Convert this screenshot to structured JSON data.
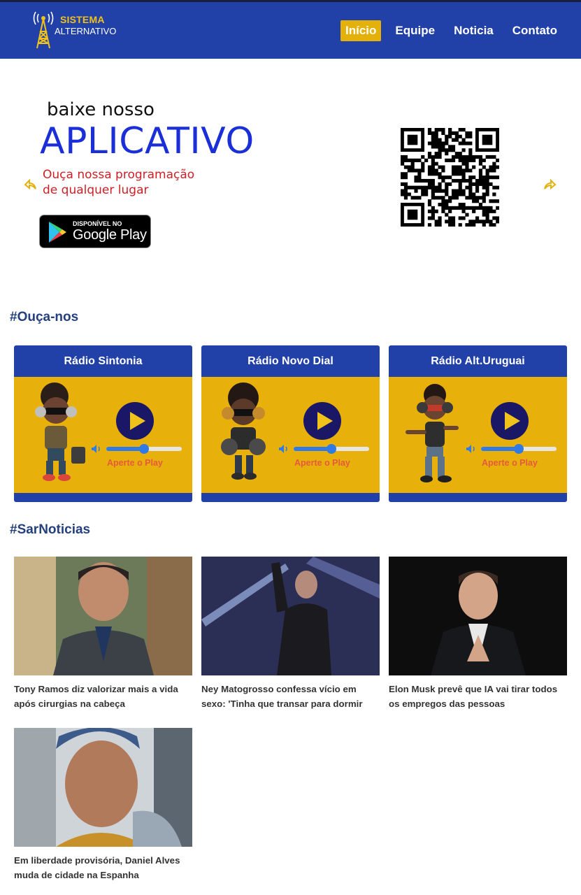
{
  "header": {
    "logo_line1": "SISTEMA",
    "logo_line2": "ALTERNATIVO",
    "nav": [
      {
        "label": "Início",
        "active": true
      },
      {
        "label": "Equipe",
        "active": false
      },
      {
        "label": "Noticia",
        "active": false
      },
      {
        "label": "Contato",
        "active": false
      }
    ]
  },
  "banner": {
    "small_text": "baixe nosso",
    "big_text": "APLICATIVO",
    "subtitle_line1": "Ouça nossa programação",
    "subtitle_line2": "de qualquer lugar",
    "store_small": "DISPONÍVEL NO",
    "store_big": "Google Play",
    "prev_icon": "arrow-left-icon",
    "next_icon": "arrow-right-icon"
  },
  "listen": {
    "title": "#Ouça-nos",
    "stations": [
      {
        "name": "Rádio Sintonia",
        "hint": "Aperte o Play",
        "volume": 0.5
      },
      {
        "name": "Rádio Novo Dial",
        "hint": "Aperte o Play",
        "volume": 0.5
      },
      {
        "name": "Rádio Alt.Uruguai",
        "hint": "Aperte o Play",
        "volume": 0.5
      }
    ]
  },
  "news": {
    "title": "#SarNoticias",
    "items": [
      {
        "title": "Tony Ramos diz valorizar mais a vida após cirurgias na cabeça"
      },
      {
        "title": "Ney Matogrosso confessa vício em sexo: 'Tinha que transar para dormir"
      },
      {
        "title": "Elon Musk prevê que IA vai tirar todos os empregos das pessoas"
      },
      {
        "title": "Em liberdade provisória, Daniel Alves muda de cidade na Espanha"
      }
    ]
  },
  "colors": {
    "header_blue": "#2140a8",
    "accent_gold": "#e7b00a",
    "play_navy": "#1a1866",
    "title_blue": "#24407e"
  }
}
